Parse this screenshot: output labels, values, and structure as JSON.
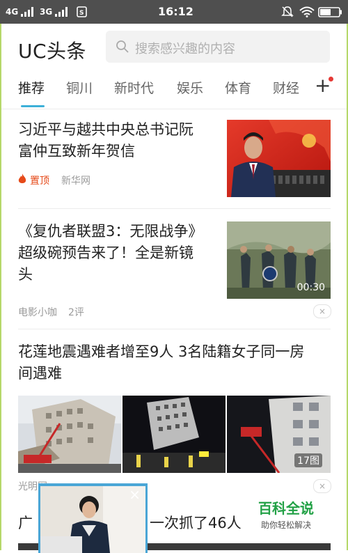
{
  "status_bar": {
    "signal1": "4G",
    "signal2": "3G",
    "time": "16:12"
  },
  "header": {
    "logo": "UC头条",
    "search_placeholder": "搜索感兴趣的内容"
  },
  "tabs": [
    {
      "label": "推荐",
      "active": true
    },
    {
      "label": "铜川"
    },
    {
      "label": "新时代"
    },
    {
      "label": "娱乐"
    },
    {
      "label": "体育"
    },
    {
      "label": "财经"
    }
  ],
  "tabs_more": "+",
  "news": [
    {
      "title_line1": "习近平与越共中央总书记阮",
      "title_line2": "富仲互致新年贺信",
      "badge": "置顶",
      "source": "新华网"
    },
    {
      "title_line1": "《复仇者联盟3：无限战争》",
      "title_line2": "超级碗预告来了！全是新镜",
      "title_line3": "头",
      "source": "电影小咖",
      "comments": "2评",
      "duration": "00:30"
    },
    {
      "title_line1": "花莲地震遇难者增至9人 3名陆籍女子同一房",
      "title_line2": "间遇难",
      "source": "光明网",
      "image_count": "17图"
    },
    {
      "title_partial_left": "广",
      "title_partial_right": "一次抓了46人"
    }
  ],
  "watermark": {
    "title": "百科全说",
    "subtitle": "助你轻松解决"
  },
  "close_glyph": "×",
  "colors": {
    "accent": "#3db0d8",
    "hot": "#e64a19",
    "watermark": "#22a146"
  }
}
